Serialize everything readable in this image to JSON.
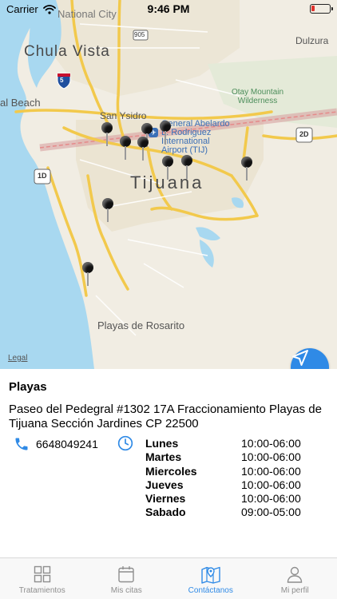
{
  "status_bar": {
    "carrier": "Carrier",
    "time": "9:46 PM"
  },
  "map": {
    "labels": {
      "city_top": "National City",
      "chula_vista": "Chula Vista",
      "beach": "al Beach",
      "dulzura": "Dulzura",
      "otay_line1": "Otay Mountain",
      "otay_line2": "Wilderness",
      "san_ysidro": "San Ysidro",
      "airport_line1": "General Abelardo",
      "airport_line2": "L. Rodriguez",
      "airport_line3": "International",
      "airport_line4": "Airport (TIJ)",
      "tijuana": "Tijuana",
      "rosarito": "Playas de Rosarito",
      "legal": "Legal"
    },
    "shields": {
      "i5": "5",
      "r905": "905",
      "r2d": "2D",
      "r1d": "1D"
    }
  },
  "location": {
    "name": "Playas",
    "address": "Paseo del Pedegral #1302 17A Fraccionamiento Playas de Tijuana Sección Jardines CP 22500",
    "phone": "6648049241",
    "hours": [
      {
        "day": "Lunes",
        "time": "10:00-06:00"
      },
      {
        "day": "Martes",
        "time": "10:00-06:00"
      },
      {
        "day": "Miercoles",
        "time": "10:00-06:00"
      },
      {
        "day": "Jueves",
        "time": "10:00-06:00"
      },
      {
        "day": "Viernes",
        "time": "10:00-06:00"
      },
      {
        "day": "Sabado",
        "time": "09:00-05:00"
      }
    ]
  },
  "tabbar": {
    "tabs": [
      {
        "label": "Tratamientos",
        "icon": "grid-icon"
      },
      {
        "label": "Mis citas",
        "icon": "calendar-icon"
      },
      {
        "label": "Contáctanos",
        "icon": "map-pin-icon",
        "active": true
      },
      {
        "label": "Mi perfil",
        "icon": "person-icon"
      }
    ]
  },
  "colors": {
    "accent": "#2f8ae6",
    "battery_low": "#e0332d",
    "ocean": "#a8d8f0"
  }
}
